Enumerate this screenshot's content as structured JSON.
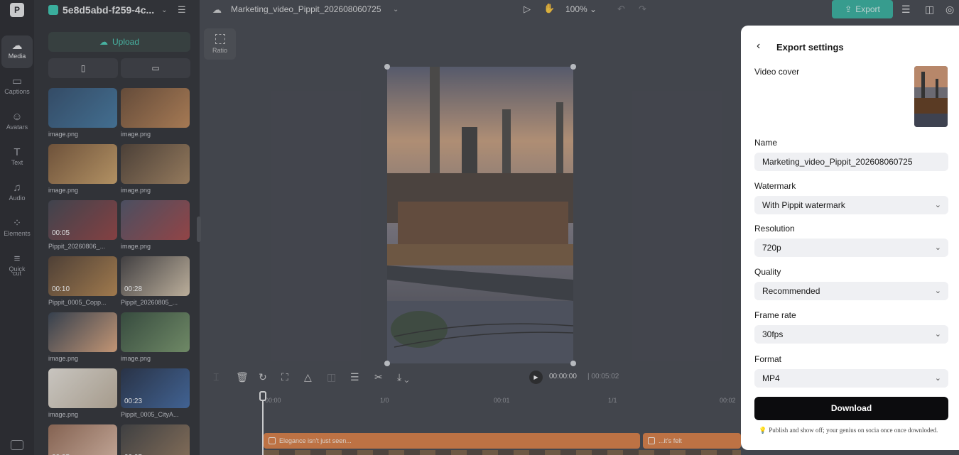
{
  "rail": {
    "items": [
      {
        "label": "Media",
        "icon": "media-icon",
        "glyph": "☁"
      },
      {
        "label": "Captions",
        "icon": "captions-icon",
        "glyph": "▭"
      },
      {
        "label": "Avatars",
        "icon": "avatars-icon",
        "glyph": "☺"
      },
      {
        "label": "Text",
        "icon": "text-icon",
        "glyph": "T"
      },
      {
        "label": "Audio",
        "icon": "audio-icon",
        "glyph": "♫"
      },
      {
        "label": "Elements",
        "icon": "elements-icon",
        "glyph": "⁘"
      },
      {
        "label": "Quick",
        "icon": "quick-cut-icon",
        "glyph": "≡"
      },
      {
        "label": "cut",
        "icon": "",
        "glyph": ""
      }
    ]
  },
  "media": {
    "project_name": "5e8d5abd-f259-4c...",
    "upload_label": "Upload",
    "seg_portrait": "▯",
    "seg_landscape": "▭",
    "items": [
      {
        "caption": "image.png",
        "duration": "",
        "colors": [
          "#1b3a5c",
          "#2f6a96"
        ]
      },
      {
        "caption": "image.png",
        "duration": "",
        "colors": [
          "#5e3a1f",
          "#b87a43"
        ]
      },
      {
        "caption": "image.png",
        "duration": "",
        "colors": [
          "#6b4320",
          "#c99a58"
        ]
      },
      {
        "caption": "image.png",
        "duration": "",
        "colors": [
          "#3b2a1c",
          "#a07a4f"
        ]
      },
      {
        "caption": "Pippit_20260806_...",
        "duration": "00:05",
        "colors": [
          "#2b2f3a",
          "#8a2a2a"
        ]
      },
      {
        "caption": "image.png",
        "duration": "",
        "colors": [
          "#3a3f55",
          "#9d3030"
        ]
      },
      {
        "caption": "Pippit_0005_Copp...",
        "duration": "00:10",
        "colors": [
          "#3f2a1a",
          "#b07a3a"
        ]
      },
      {
        "caption": "Pippit_20260805_...",
        "duration": "00:28",
        "colors": [
          "#2e2a2a",
          "#d6c3a5"
        ]
      },
      {
        "caption": "image.png",
        "duration": "",
        "colors": [
          "#1d2a3a",
          "#e0a070"
        ]
      },
      {
        "caption": "image.png",
        "duration": "",
        "colors": [
          "#1f3a26",
          "#6d8f5c"
        ]
      },
      {
        "caption": "image.png",
        "duration": "",
        "colors": [
          "#e8e2d8",
          "#b8a890"
        ]
      },
      {
        "caption": "Pippit_0005_CityA...",
        "duration": "00:23",
        "colors": [
          "#0c1830",
          "#2d5a9a"
        ]
      },
      {
        "caption": "",
        "duration": "00:05",
        "colors": [
          "#8a5a40",
          "#e0b8a0"
        ]
      },
      {
        "caption": "",
        "duration": "00:05",
        "colors": [
          "#2a2a2a",
          "#8a6a4a"
        ]
      }
    ]
  },
  "topbar": {
    "file_name": "Marketing_video_Pippit_202608060725",
    "zoom": "100%",
    "export_label": "Export"
  },
  "canvas": {
    "ratio_label": "Ratio"
  },
  "player": {
    "current_time": "00:00:00",
    "total_time": "00:05:02"
  },
  "timeline": {
    "ticks": [
      "00:00",
      "1/0",
      "00:01",
      "1/1",
      "00:02"
    ],
    "clips": [
      {
        "label": "Elegance isn't just seen..."
      },
      {
        "label": "...it's felt"
      }
    ]
  },
  "export_panel": {
    "title": "Export settings",
    "video_cover_label": "Video cover",
    "name_label": "Name",
    "name_value": "Marketing_video_Pippit_202608060725",
    "watermark_label": "Watermark",
    "watermark_value": "With Pippit watermark",
    "resolution_label": "Resolution",
    "resolution_value": "720p",
    "quality_label": "Quality",
    "quality_value": "Recommended",
    "frame_rate_label": "Frame rate",
    "frame_rate_value": "30fps",
    "format_label": "Format",
    "format_value": "MP4",
    "download_label": "Download",
    "note": "Publish and show off; your genius on socia once once downloded."
  },
  "colors": {
    "accent": "#1fa993",
    "panel": "#ffffff",
    "download": "#0c0c0e",
    "clip": "#d9702d"
  }
}
